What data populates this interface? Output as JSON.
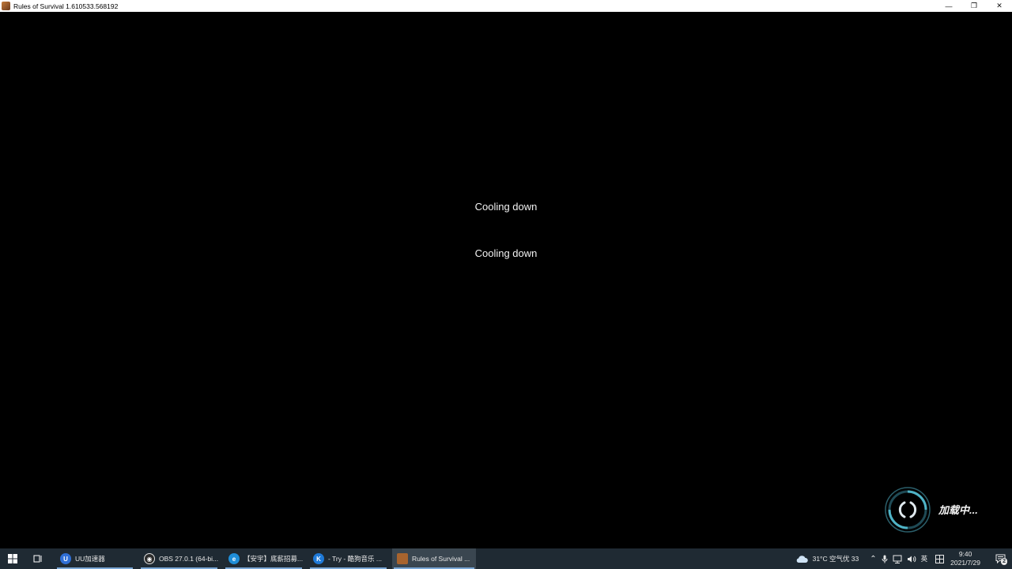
{
  "window": {
    "title": "Rules of Survival 1.610533.568192",
    "controls": {
      "minimize": "—",
      "restore": "❐",
      "close": "✕"
    }
  },
  "game": {
    "messages": [
      "Cooling down",
      "Cooling down"
    ],
    "loading_label": "加载中..."
  },
  "taskbar": {
    "tasks": [
      {
        "label": "UU加速器",
        "icon": "uu-accelerator-icon",
        "color": "#2f6fd6"
      },
      {
        "label": "OBS 27.0.1 (64-bi...",
        "icon": "obs-icon",
        "color": "#2b2b2b"
      },
      {
        "label": "【安宇】底薪招募...",
        "icon": "edge-browser-icon",
        "color": "#1f8ed8"
      },
      {
        "label": "- Try - 酷狗音乐 ...",
        "icon": "kugou-music-icon",
        "color": "#1f7ad8"
      },
      {
        "label": "Rules of Survival ...",
        "icon": "rules-of-survival-icon",
        "color": "#a8642e"
      }
    ],
    "tray": {
      "weather": "31°C  空气优 33",
      "ime": "英",
      "time": "9:40",
      "date": "2021/7/29",
      "notifications": "2"
    }
  }
}
